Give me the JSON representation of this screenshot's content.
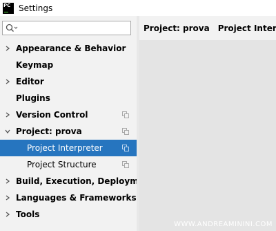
{
  "window": {
    "title": "Settings",
    "app_icon_text": "PC"
  },
  "sidebar": {
    "search": {
      "value": "",
      "placeholder": ""
    },
    "items": [
      {
        "label": "Appearance & Behavior",
        "has_arrow": true,
        "expanded": false,
        "copy": false
      },
      {
        "label": "Keymap",
        "has_arrow": false,
        "copy": false
      },
      {
        "label": "Editor",
        "has_arrow": true,
        "expanded": false,
        "copy": false
      },
      {
        "label": "Plugins",
        "has_arrow": false,
        "copy": false
      },
      {
        "label": "Version Control",
        "has_arrow": true,
        "expanded": false,
        "copy": true
      },
      {
        "label": "Project: prova",
        "has_arrow": true,
        "expanded": true,
        "copy": true
      },
      {
        "label": "Project Interpreter",
        "sub": true,
        "selected": true,
        "copy": true
      },
      {
        "label": "Project Structure",
        "sub": true,
        "copy": true
      },
      {
        "label": "Build, Execution, Deployment",
        "has_arrow": true,
        "expanded": false,
        "copy": false
      },
      {
        "label": "Languages & Frameworks",
        "has_arrow": true,
        "expanded": false,
        "copy": false
      },
      {
        "label": "Tools",
        "has_arrow": true,
        "expanded": false,
        "copy": false
      }
    ]
  },
  "breadcrumb": {
    "parent": "Project: prova",
    "current": "Project Interpreter"
  },
  "watermark": "WWW.ANDREAMININI.COM",
  "colors": {
    "selection": "#2675bf",
    "sidebar_bg": "#f2f2f2",
    "content_bg": "#e4e4e4"
  },
  "icons": {
    "search": "search-icon",
    "expand": "chevron-right-icon",
    "collapse": "chevron-down-icon",
    "copy": "copy-icon",
    "separator": "chevron-right-icon"
  }
}
